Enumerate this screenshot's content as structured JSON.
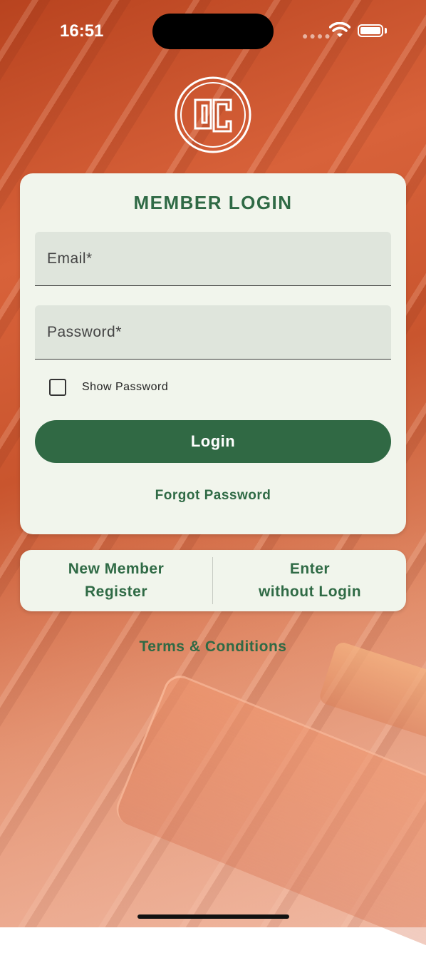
{
  "status_bar": {
    "time": "16:51",
    "icons": [
      "signal-dots-icon",
      "wifi-icon",
      "battery-icon"
    ]
  },
  "logo": {
    "monogram": "OC"
  },
  "login_card": {
    "title": "MEMBER LOGIN",
    "email_placeholder": "Email*",
    "email_value": "",
    "password_placeholder": "Password*",
    "password_value": "",
    "show_password_label": "Show Password",
    "show_password_checked": false,
    "login_label": "Login",
    "forgot_label": "Forgot Password"
  },
  "actions": {
    "register_line1": "New Member",
    "register_line2": "Register",
    "enter_line1": "Enter",
    "enter_line2": "without Login"
  },
  "terms_label": "Terms & Conditions",
  "colors": {
    "brand_green": "#306944",
    "card_bg": "#f1f5ec",
    "field_bg": "#dfe5dc"
  }
}
